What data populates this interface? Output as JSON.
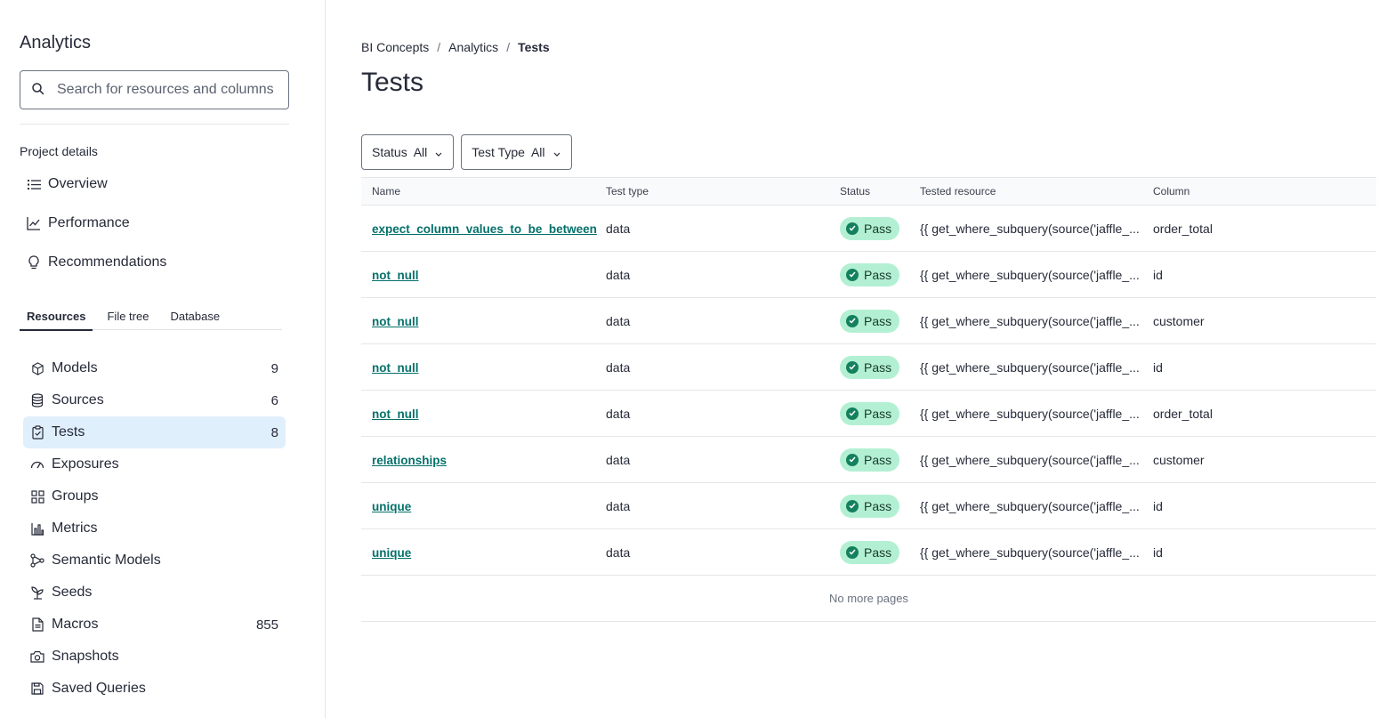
{
  "sidebar": {
    "title": "Analytics",
    "search": {
      "placeholder": "Search for resources and columns",
      "value": ""
    },
    "project_details_label": "Project details",
    "project_items": [
      {
        "label": "Overview",
        "icon": "list-icon"
      },
      {
        "label": "Performance",
        "icon": "line-chart-icon"
      },
      {
        "label": "Recommendations",
        "icon": "lightbulb-icon"
      }
    ],
    "tabs": [
      {
        "label": "Resources",
        "active": true
      },
      {
        "label": "File tree",
        "active": false
      },
      {
        "label": "Database",
        "active": false
      }
    ],
    "resources": [
      {
        "label": "Models",
        "count": "9",
        "icon": "cube-icon"
      },
      {
        "label": "Sources",
        "count": "6",
        "icon": "database-icon"
      },
      {
        "label": "Tests",
        "count": "8",
        "icon": "clipboard-check-icon",
        "active": true
      },
      {
        "label": "Exposures",
        "count": "",
        "icon": "gauge-icon"
      },
      {
        "label": "Groups",
        "count": "",
        "icon": "grid-icon"
      },
      {
        "label": "Metrics",
        "count": "",
        "icon": "bar-chart-icon"
      },
      {
        "label": "Semantic Models",
        "count": "",
        "icon": "graph-nodes-icon"
      },
      {
        "label": "Seeds",
        "count": "",
        "icon": "sprout-icon"
      },
      {
        "label": "Macros",
        "count": "855",
        "icon": "file-icon"
      },
      {
        "label": "Snapshots",
        "count": "",
        "icon": "camera-icon"
      },
      {
        "label": "Saved Queries",
        "count": "",
        "icon": "floppy-disk-icon"
      }
    ]
  },
  "main": {
    "breadcrumb": [
      "BI Concepts",
      "Analytics",
      "Tests"
    ],
    "title": "Tests",
    "filters": [
      {
        "label": "Status",
        "value": "All"
      },
      {
        "label": "Test Type",
        "value": "All"
      }
    ],
    "table": {
      "columns": [
        "Name",
        "Test type",
        "Status",
        "Tested resource",
        "Column"
      ],
      "rows": [
        {
          "name": "expect_column_values_to_be_between",
          "type": "data",
          "status": "Pass",
          "resource": "{{ get_where_subquery(source('jaffle_...",
          "column": "order_total"
        },
        {
          "name": "not_null",
          "type": "data",
          "status": "Pass",
          "resource": "{{ get_where_subquery(source('jaffle_...",
          "column": "id"
        },
        {
          "name": "not_null",
          "type": "data",
          "status": "Pass",
          "resource": "{{ get_where_subquery(source('jaffle_...",
          "column": "customer"
        },
        {
          "name": "not_null",
          "type": "data",
          "status": "Pass",
          "resource": "{{ get_where_subquery(source('jaffle_...",
          "column": "id"
        },
        {
          "name": "not_null",
          "type": "data",
          "status": "Pass",
          "resource": "{{ get_where_subquery(source('jaffle_...",
          "column": "order_total"
        },
        {
          "name": "relationships",
          "type": "data",
          "status": "Pass",
          "resource": "{{ get_where_subquery(source('jaffle_...",
          "column": "customer"
        },
        {
          "name": "unique",
          "type": "data",
          "status": "Pass",
          "resource": "{{ get_where_subquery(source('jaffle_...",
          "column": "id"
        },
        {
          "name": "unique",
          "type": "data",
          "status": "Pass",
          "resource": "{{ get_where_subquery(source('jaffle_...",
          "column": "id"
        }
      ],
      "footer": "No more pages"
    }
  },
  "colors": {
    "link": "#04716a",
    "pass_badge_bg": "#b3f0d3",
    "pass_check": "#14805e",
    "active_nav_bg": "#e0effc",
    "text": "#262a38"
  }
}
